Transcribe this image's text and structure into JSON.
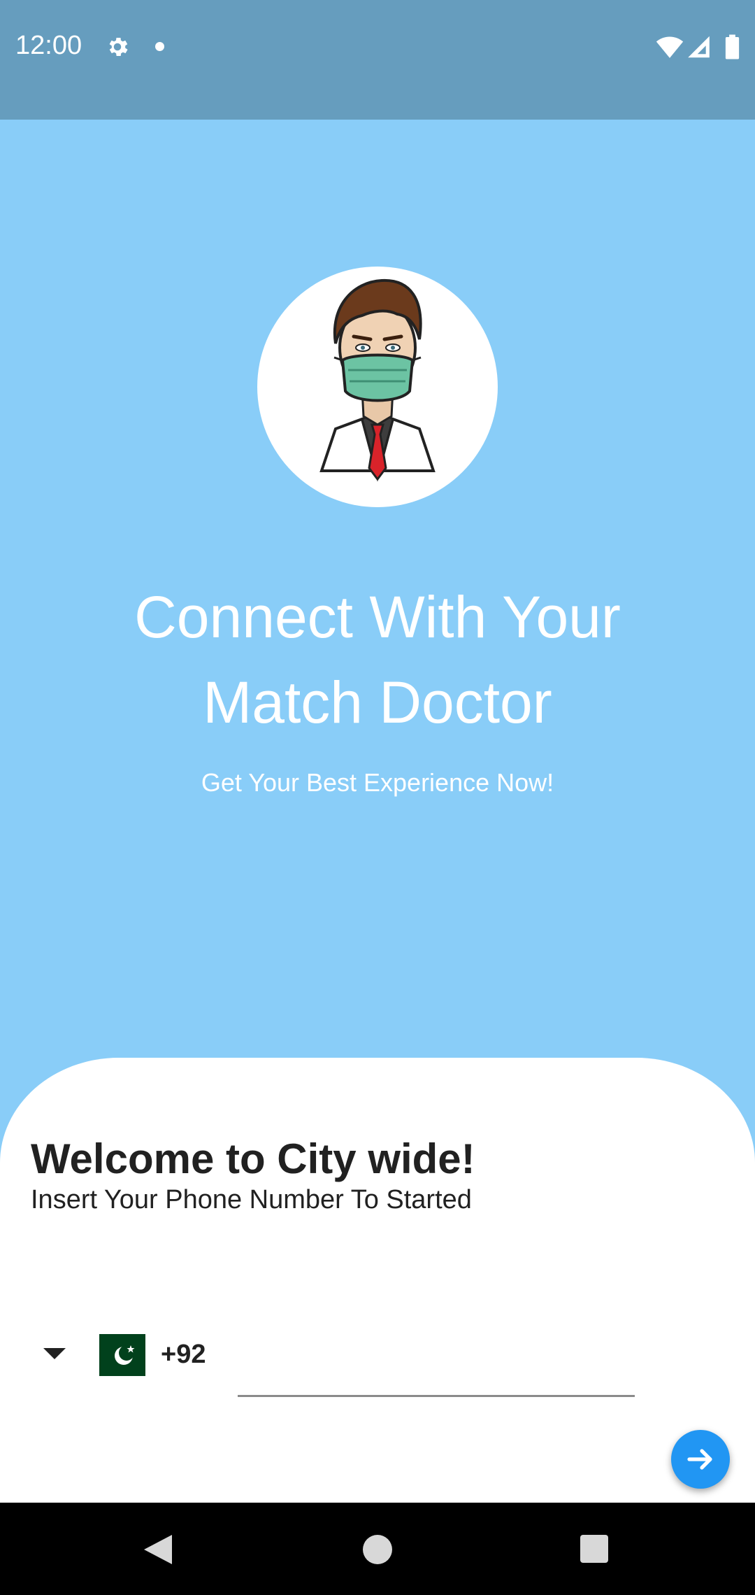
{
  "status_bar": {
    "time": "12:00",
    "icons": [
      "gear-icon",
      "notification-dot-icon",
      "wifi-icon",
      "cell-signal-icon",
      "battery-icon"
    ],
    "background": "#669DBE"
  },
  "hero": {
    "background": "#89CDF8",
    "image": "doctor-with-mask-illustration",
    "title": "Connect With Your Match Doctor",
    "subtitle": "Get Your Best Experience Now!"
  },
  "login": {
    "title": "Welcome to City wide!",
    "subtitle": "Insert Your Phone Number To Started",
    "country": {
      "flag": "pakistan-flag-icon",
      "dial_code": "+92"
    },
    "phone": {
      "value": "",
      "placeholder": ""
    },
    "next_button": {
      "icon": "arrow-right-icon",
      "color": "#2196F3"
    }
  },
  "nav_bar": {
    "icons": [
      "back-icon",
      "home-icon",
      "recents-icon"
    ]
  }
}
